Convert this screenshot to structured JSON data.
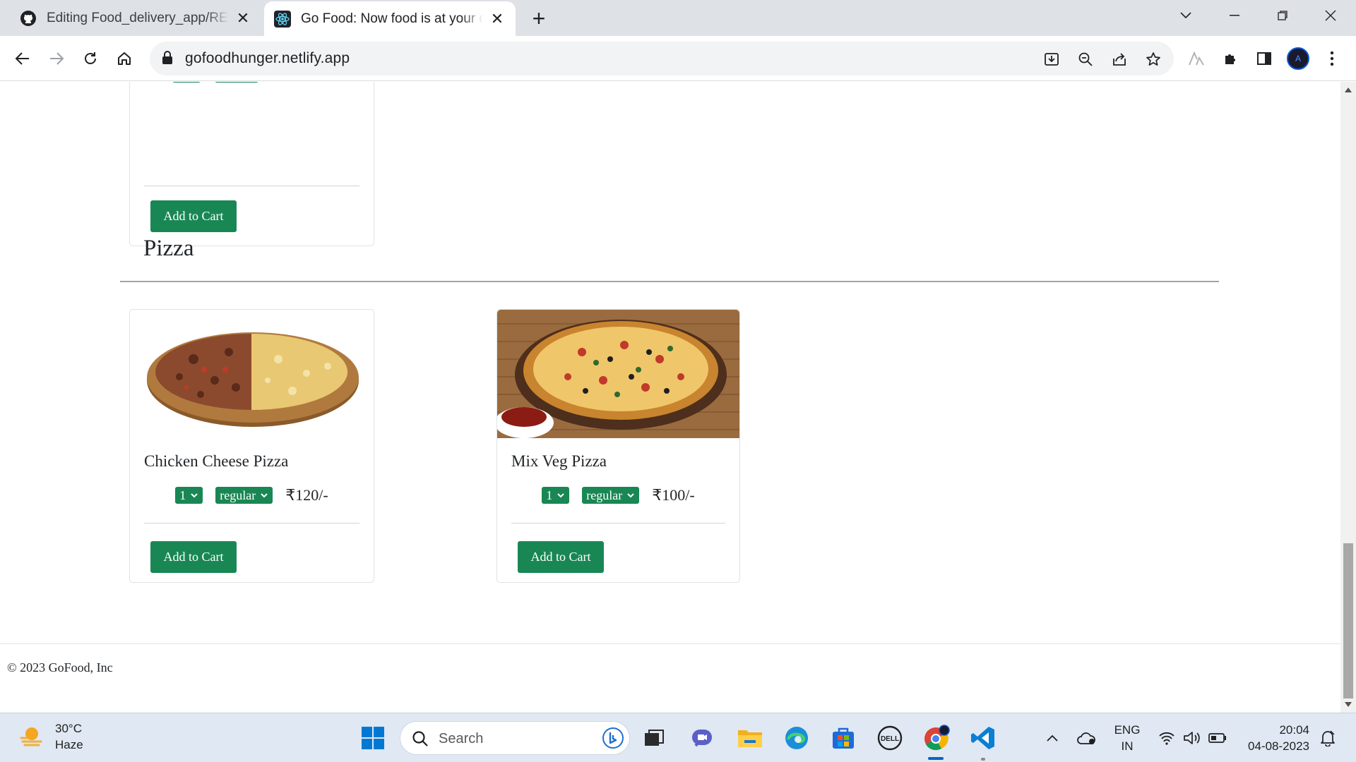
{
  "browser": {
    "tabs": [
      {
        "title": "Editing Food_delivery_app/README.md",
        "icon": "github-icon",
        "active": false
      },
      {
        "title": "Go Food: Now food is at your door",
        "icon": "react-icon",
        "active": true
      }
    ],
    "url": "gofoodhunger.netlify.app"
  },
  "page": {
    "top_card": {
      "add_button": "Add to Cart"
    },
    "section_title": "Pizza",
    "cards": [
      {
        "name": "Chicken Cheese Pizza",
        "qty": "1",
        "size": "regular",
        "price": "₹120/-",
        "add_button": "Add to Cart"
      },
      {
        "name": "Mix Veg Pizza",
        "qty": "1",
        "size": "regular",
        "price": "₹100/-",
        "add_button": "Add to Cart"
      }
    ],
    "footer": "© 2023 GoFood, Inc"
  },
  "taskbar": {
    "weather": {
      "temp": "30°C",
      "condition": "Haze"
    },
    "search_placeholder": "Search",
    "lang": {
      "line1": "ENG",
      "line2": "IN"
    },
    "clock": {
      "time": "20:04",
      "date": "04-08-2023"
    }
  },
  "colors": {
    "accent_green": "#198754",
    "tab_strip": "#dee1e6",
    "taskbar": "#dfe8f3"
  }
}
